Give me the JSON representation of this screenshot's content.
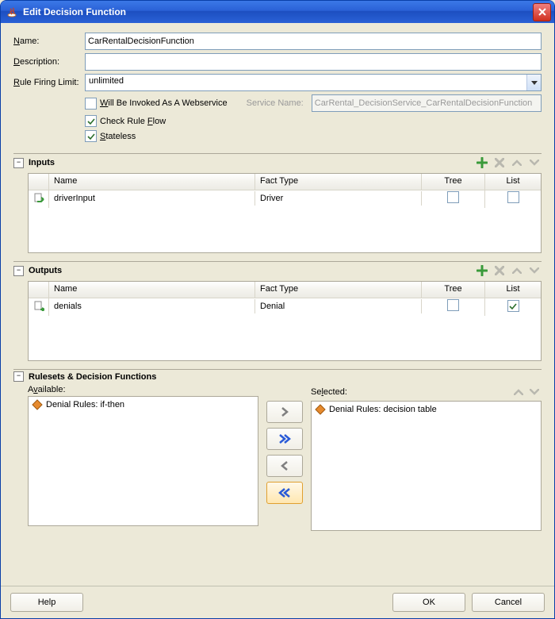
{
  "window": {
    "title": "Edit Decision Function",
    "icon": "java-cup-icon"
  },
  "form": {
    "name_label_pre": "N",
    "name_label_rest": "ame:",
    "name_value": "CarRentalDecisionFunction",
    "desc_label_pre": "D",
    "desc_label_rest": "escription:",
    "desc_value": "",
    "rfl_label_pre": "R",
    "rfl_label_rest": "ule Firing Limit:",
    "rfl_value": "unlimited",
    "webservice_checked": false,
    "webservice_label": "Will Be Invoked As A Webservice",
    "webservice_underline": "W",
    "service_name_label": "Service Name:",
    "service_name_value": "CarRental_DecisionService_CarRentalDecisionFunction",
    "checkflow_checked": true,
    "checkflow_label": "Check Rule Flow",
    "checkflow_underline": "F",
    "stateless_checked": true,
    "stateless_label": "Stateless",
    "stateless_underline": "S"
  },
  "inputs": {
    "title": "Inputs",
    "columns": {
      "name": "Name",
      "fact": "Fact Type",
      "tree": "Tree",
      "list": "List"
    },
    "rows": [
      {
        "name": "driverInput",
        "fact": "Driver",
        "tree": false,
        "list": false
      }
    ]
  },
  "outputs": {
    "title": "Outputs",
    "columns": {
      "name": "Name",
      "fact": "Fact Type",
      "tree": "Tree",
      "list": "List"
    },
    "rows": [
      {
        "name": "denials",
        "fact": "Denial",
        "tree": false,
        "list": true
      }
    ]
  },
  "rulesets": {
    "title": "Rulesets & Decision Functions",
    "available_label": "Available:",
    "selected_label": "Selected:",
    "available": [
      {
        "label": "Denial Rules: if-then"
      }
    ],
    "selected": [
      {
        "label": "Denial Rules: decision table"
      }
    ]
  },
  "footer": {
    "help": "Help",
    "ok": "OK",
    "cancel": "Cancel"
  }
}
